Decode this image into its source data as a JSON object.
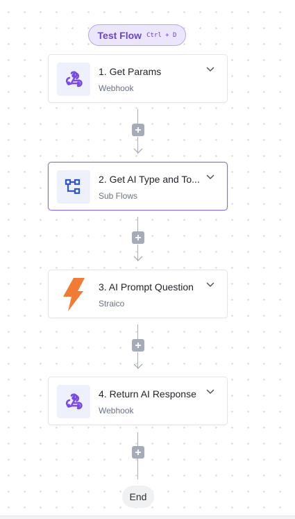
{
  "test_flow": {
    "label": "Test Flow",
    "shortcut": "Ctrl + D"
  },
  "steps": [
    {
      "title": "1. Get Params",
      "subtitle": "Webhook",
      "icon": "webhook-icon",
      "selected": false
    },
    {
      "title": "2. Get AI Type and To...",
      "subtitle": "Sub Flows",
      "icon": "sub-flows-icon",
      "selected": true
    },
    {
      "title": "3. AI Prompt Question",
      "subtitle": "Straico",
      "icon": "straico-bolt-icon",
      "selected": false
    },
    {
      "title": "4. Return AI Response",
      "subtitle": "Webhook",
      "icon": "webhook-icon",
      "selected": false
    }
  ],
  "end": {
    "label": "End"
  },
  "colors": {
    "accent": "#6d3fd6",
    "webhook_icon": "#7b4be6",
    "subflow_icon": "#2f55d4",
    "straico_icon": "#f07b35",
    "connector": "#a6acb7"
  }
}
